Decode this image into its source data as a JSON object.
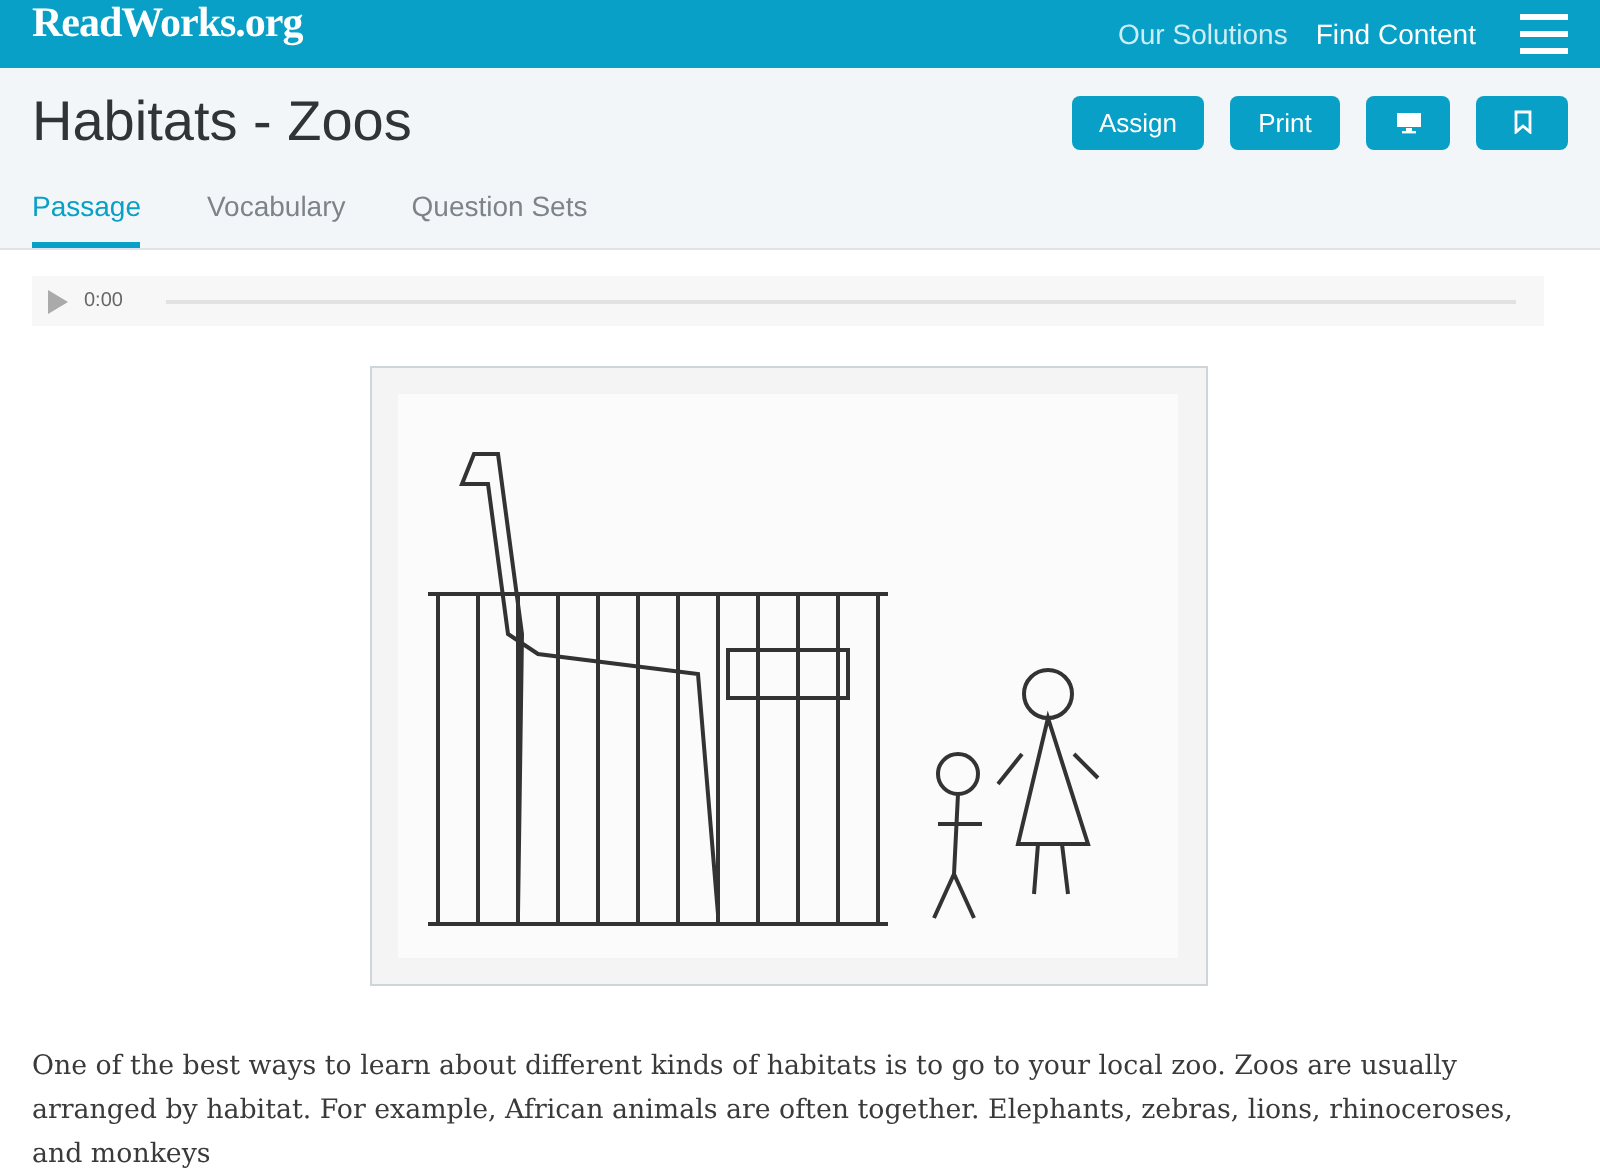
{
  "header": {
    "logo": "ReadWorks.org",
    "nav": [
      "Our Solutions",
      "Find Content"
    ]
  },
  "title": "Habitats - Zoos",
  "actions": [
    {
      "kind": "text",
      "label": "Assign"
    },
    {
      "kind": "text",
      "label": "Print"
    },
    {
      "kind": "monitor"
    },
    {
      "kind": "bookmark"
    }
  ],
  "tabs": [
    {
      "label": "Passage",
      "selected": true
    },
    {
      "label": "Vocabulary",
      "selected": false
    },
    {
      "label": "Question Sets",
      "selected": false
    }
  ],
  "audio": {
    "time": "0:00"
  },
  "paragraph": "One of the best ways to learn about different kinds of habitats is to go to your local zoo. Zoos are usually arranged by habitat. For example, African animals are often together. Elephants, zebras, lions, rhinoceroses, and monkeys"
}
